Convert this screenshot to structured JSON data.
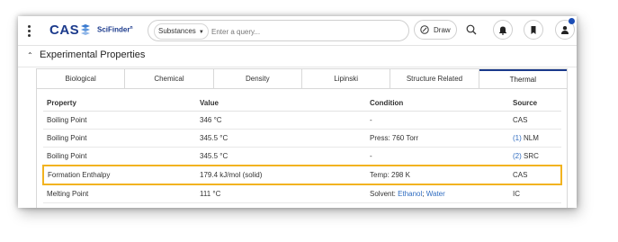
{
  "app": {
    "logo_text": "CAS",
    "product_name": "SciFinder",
    "product_mark": "n",
    "brand_color": "#1b3a8c"
  },
  "search": {
    "type_label": "Substances",
    "placeholder": "Enter a query..."
  },
  "toolbar": {
    "draw_label": "Draw"
  },
  "section": {
    "title": "Experimental Properties"
  },
  "tabs": [
    {
      "label": "Biological",
      "active": false
    },
    {
      "label": "Chemical",
      "active": false
    },
    {
      "label": "Density",
      "active": false
    },
    {
      "label": "Lipinski",
      "active": false
    },
    {
      "label": "Structure Related",
      "active": false
    },
    {
      "label": "Thermal",
      "active": true
    }
  ],
  "table": {
    "headers": [
      "Property",
      "Value",
      "Condition",
      "Source"
    ],
    "rows": [
      {
        "property": "Boiling Point",
        "value": "346 °C",
        "condition": "-",
        "source_ref": "",
        "source": "CAS",
        "highlighted": false
      },
      {
        "property": "Boiling Point",
        "value": "345.5 °C",
        "condition": "Press: 760 Torr",
        "source_ref": "(1)",
        "source": "NLM",
        "highlighted": false
      },
      {
        "property": "Boiling Point",
        "value": "345.5 °C",
        "condition": "-",
        "source_ref": "(2)",
        "source": "SRC",
        "highlighted": false
      },
      {
        "property": "Formation Enthalpy",
        "value": "179.4 kJ/mol (solid)",
        "condition": "Temp: 298 K",
        "source_ref": "",
        "source": "CAS",
        "highlighted": true
      },
      {
        "property": "Melting Point",
        "value": "111 °C",
        "condition_prefix": "Solvent:",
        "condition_links": [
          "Ethanol",
          "Water"
        ],
        "source_ref": "",
        "source": "IC",
        "highlighted": false
      }
    ]
  },
  "colors": {
    "highlight": "#f2b320",
    "link": "#2f6cc0",
    "notification_dot": "#1b4db5"
  }
}
